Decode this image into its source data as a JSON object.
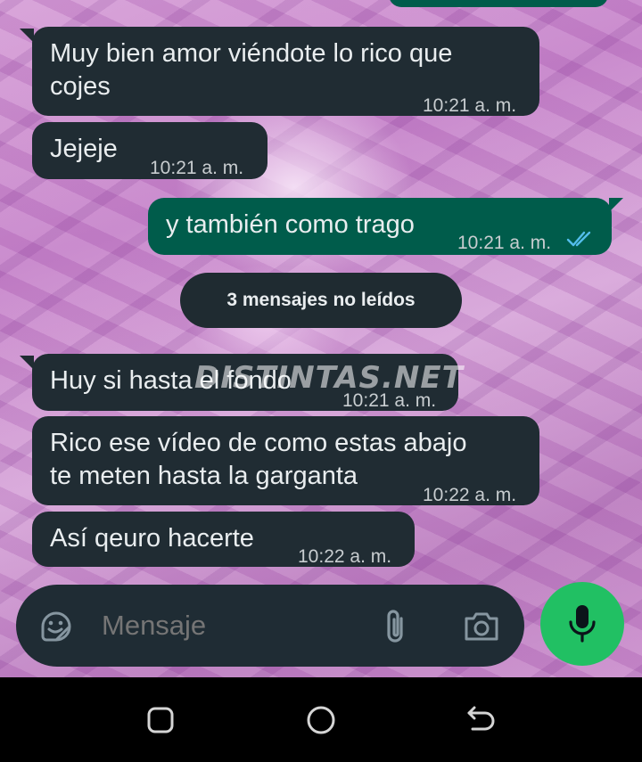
{
  "messages": [
    {
      "direction": "in",
      "text_line1": "Muy bien amor viéndote lo rico que",
      "text_line2": "cojes",
      "time": "10:21 a. m."
    },
    {
      "direction": "in",
      "text": "Jejeje",
      "time": "10:21 a. m."
    },
    {
      "direction": "out",
      "text": "y también como trago",
      "time": "10:21 a. m.",
      "status": "read"
    },
    {
      "direction": "in",
      "text": "Huy si hasta el fondo",
      "time": "10:21 a. m."
    },
    {
      "direction": "in",
      "text_line1": "Rico ese vídeo de como estas abajo",
      "text_line2": "te meten hasta la garganta",
      "time": "10:22 a. m."
    },
    {
      "direction": "in",
      "text": "Así qeuro hacerte",
      "time": "10:22 a. m."
    }
  ],
  "unread_divider": "3 mensajes no leídos",
  "watermark": "DISTINTAS.NET",
  "composer": {
    "placeholder": "Mensaje"
  },
  "icons": {
    "emoji": "sticker-smile-icon",
    "attach": "paperclip-icon",
    "camera": "camera-icon",
    "mic": "microphone-icon",
    "read_receipt": "double-check-icon"
  },
  "colors": {
    "incoming_bubble": "#202c33",
    "outgoing_bubble": "#005c4b",
    "read_check": "#53bdeb",
    "mic_button": "#21c063",
    "input_bar": "#1f2c34"
  },
  "nav": {
    "buttons": [
      "recents",
      "home",
      "back"
    ]
  }
}
